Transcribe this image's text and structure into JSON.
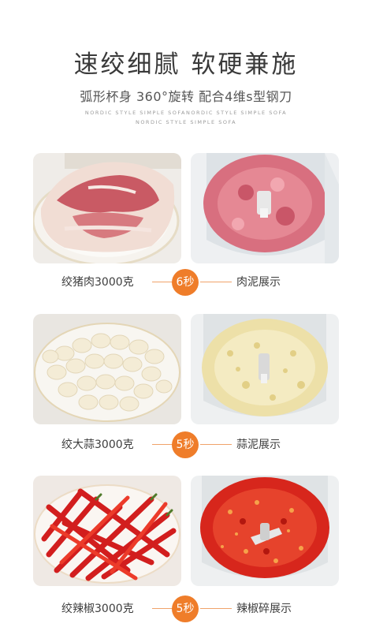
{
  "header": {
    "title": "速绞细腻 软硬兼施",
    "subtitle": "弧形杯身 360°旋转 配合4维s型钢刀",
    "nordic_line1": "NORDIC STYLE SIMPLE SOFANORDIC STYLE SIMPLE SOFA",
    "nordic_line2": "NORDIC STYLE SIMPLE SOFA"
  },
  "rows": [
    {
      "left_label": "绞猪肉3000克",
      "badge": "6秒",
      "right_label": "肉泥展示"
    },
    {
      "left_label": "绞大蒜3000克",
      "badge": "5秒",
      "right_label": "蒜泥展示"
    },
    {
      "left_label": "绞辣椒3000克",
      "badge": "5秒",
      "right_label": "辣椒碎展示"
    }
  ],
  "colors": {
    "accent": "#ef7d2a",
    "line": "#f0a36a"
  }
}
